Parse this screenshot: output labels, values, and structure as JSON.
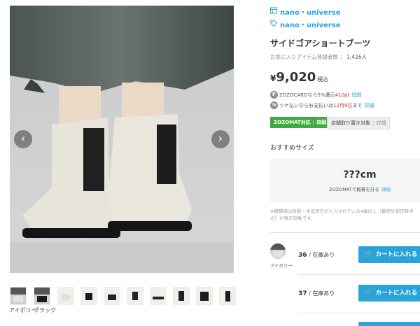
{
  "gallery": {
    "prev_arrow": "‹",
    "next_arrow": "›",
    "thumb_labels": [
      "アイボリー",
      "ブラック"
    ]
  },
  "product": {
    "brand_primary": "nano・universe",
    "brand_secondary": "nano・universe",
    "title": "サイドゴアショートブーツ",
    "favorites_label": "お気に入りアイテム登録者数",
    "favorites_sep": "：",
    "favorites_count": "1,426人",
    "price_currency": "¥",
    "price_value": "9,020",
    "price_tax": "税込",
    "promo1": {
      "icon": "P",
      "text_pre": "ZOZOCARDなら5%還元",
      "text_highlight": "410pt",
      "link": "詳細"
    },
    "promo2": {
      "icon": "%",
      "text_pre": "ツケ払いならお支払いは",
      "text_highlight": "12月9日",
      "text_post": "まで",
      "link": "詳細"
    },
    "badge_zozomat": "ZOZOMAT対応",
    "badge_zozomat_link": "詳細",
    "badge_store": "店舗取り置き対象",
    "badge_store_link": "詳細"
  },
  "size": {
    "section_title": "おすすめサイズ",
    "value": "???cm",
    "cta": "ZOZOMATで概算を計る",
    "cta_link": "詳細",
    "note": "※概算値は性別・生年月日が入力されている4歳以上（最終計測日時点の）が表示対象です。"
  },
  "variants": {
    "color_label": "アイボリー",
    "rows": [
      {
        "size": "36",
        "sep": " / ",
        "status": "在庫あり",
        "cart": "カートに入れる"
      },
      {
        "size": "37",
        "sep": " / ",
        "status": "在庫あり",
        "cart": "カートに入れる"
      }
    ]
  },
  "colors": {
    "accent": "#2aa4d8",
    "green": "#3fab3f",
    "red": "#d42a2a"
  }
}
